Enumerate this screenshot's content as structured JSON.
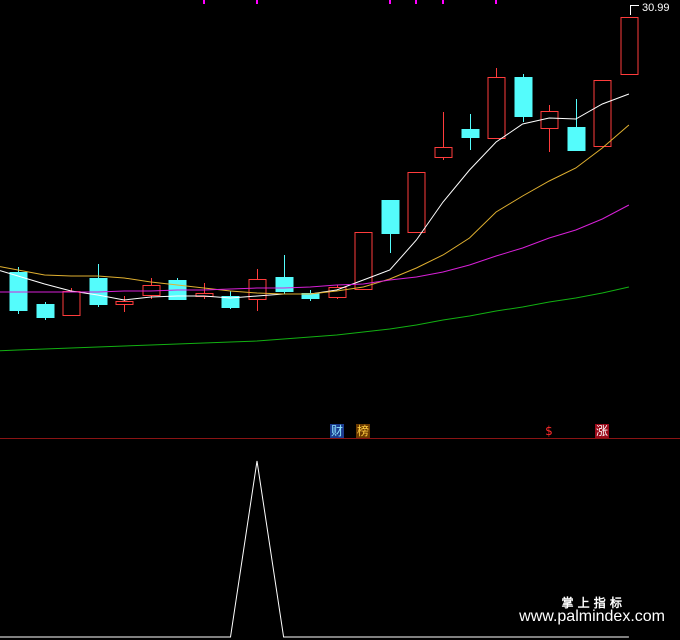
{
  "chart_data": {
    "type": "candlestick",
    "ylim": [
      9.94,
      31.84
    ],
    "grid": false,
    "max_price_label": "30.99",
    "colors": {
      "up": "#ff3c3c",
      "down": "#54fcfc",
      "marker": "#ff00ff"
    },
    "open": [
      18.24,
      16.64,
      16.09,
      17.94,
      16.64,
      17.09,
      17.84,
      17.04,
      17.04,
      16.89,
      17.99,
      17.19,
      16.99,
      17.39,
      21.84,
      20.24,
      23.99,
      25.39,
      24.94,
      27.99,
      25.44,
      25.49,
      24.54,
      28.14
    ],
    "high": [
      18.49,
      16.74,
      17.44,
      18.64,
      17.04,
      17.94,
      17.94,
      17.69,
      17.29,
      18.39,
      19.09,
      17.34,
      17.59,
      20.24,
      21.84,
      23.24,
      26.24,
      26.14,
      28.44,
      28.14,
      26.59,
      26.89,
      27.84,
      30.99
    ],
    "low": [
      16.14,
      15.84,
      16.04,
      16.49,
      16.24,
      16.89,
      16.84,
      16.89,
      16.39,
      16.29,
      17.14,
      16.79,
      16.89,
      17.34,
      19.19,
      20.24,
      23.84,
      24.34,
      24.94,
      25.74,
      24.24,
      24.34,
      24.54,
      28.14
    ],
    "close": [
      16.34,
      15.99,
      17.29,
      16.64,
      16.79,
      17.59,
      16.89,
      17.19,
      16.49,
      17.89,
      17.29,
      16.94,
      17.49,
      20.24,
      20.19,
      23.24,
      24.49,
      24.99,
      27.99,
      26.04,
      26.29,
      24.34,
      27.84,
      30.99
    ],
    "series": [
      {
        "color": "#ffffff",
        "values": [
          18.04,
          17.64,
          17.29,
          17.09,
          16.84,
          16.99,
          17.04,
          17.04,
          16.94,
          17.04,
          17.14,
          17.14,
          17.34,
          17.84,
          18.34,
          19.84,
          21.74,
          23.34,
          24.74,
          25.64,
          25.94,
          25.89,
          26.64,
          27.14
        ]
      },
      {
        "color": "#e0b030",
        "values": [
          18.34,
          18.09,
          18.04,
          18.04,
          17.94,
          17.74,
          17.59,
          17.44,
          17.29,
          17.19,
          17.14,
          17.14,
          17.29,
          17.49,
          17.89,
          18.44,
          19.09,
          19.94,
          21.24,
          22.04,
          22.79,
          23.44,
          24.44,
          25.59
        ]
      },
      {
        "color": "#d820d8",
        "values": [
          17.24,
          17.24,
          17.24,
          17.24,
          17.29,
          17.29,
          17.34,
          17.34,
          17.39,
          17.44,
          17.44,
          17.49,
          17.59,
          17.64,
          17.84,
          17.99,
          18.24,
          18.59,
          19.04,
          19.44,
          19.94,
          20.34,
          20.89,
          21.59
        ]
      },
      {
        "color": "#12b012",
        "values": [
          14.34,
          14.39,
          14.44,
          14.49,
          14.54,
          14.59,
          14.64,
          14.69,
          14.74,
          14.79,
          14.89,
          14.99,
          15.09,
          15.24,
          15.39,
          15.59,
          15.84,
          16.04,
          16.29,
          16.49,
          16.74,
          16.94,
          17.19,
          17.49
        ]
      }
    ],
    "top_markers": [
      7,
      9,
      14,
      15,
      16,
      18
    ],
    "signals": [
      {
        "index": 12,
        "text": "财",
        "color": "#8fe6ff",
        "bg": "#1b3c8f"
      },
      {
        "index": 13,
        "text": "榜",
        "color": "#ffcc40",
        "bg": "#6b3a00"
      },
      {
        "index": 20,
        "text": "$",
        "color": "#ff2a2a"
      },
      {
        "index": 22,
        "text": "涨",
        "color": "#ffffff",
        "bg": "#9a0a1a"
      }
    ],
    "indicator": {
      "color": "#ffffff",
      "ylim": [
        0,
        1
      ],
      "values": [
        0,
        0,
        0,
        0,
        0,
        0,
        0,
        0,
        0,
        1,
        0,
        0,
        0,
        0,
        0,
        0,
        0,
        0,
        0,
        0,
        0,
        0,
        0,
        0
      ]
    }
  },
  "watermark": {
    "title": "掌 上 指 标",
    "url": "www.palmindex.com"
  }
}
